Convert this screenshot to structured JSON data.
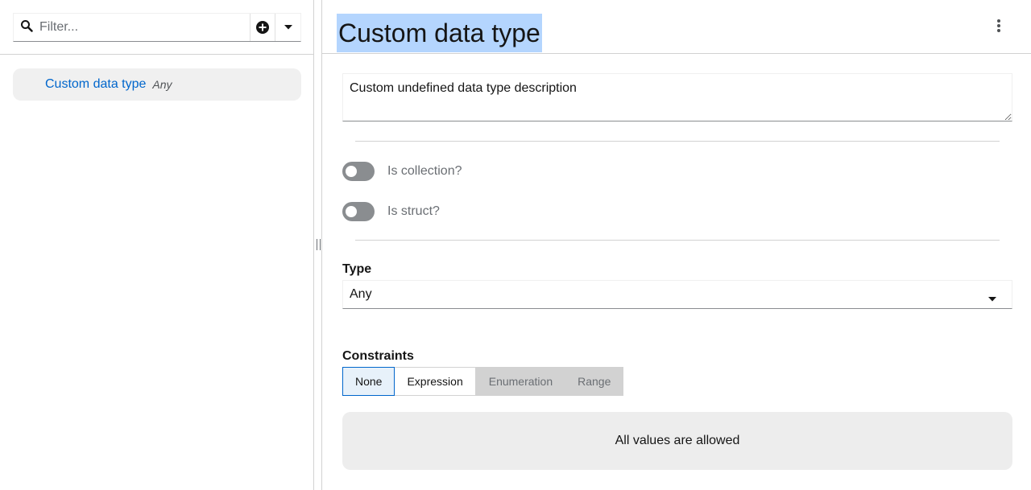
{
  "sidebar": {
    "filter": {
      "placeholder": "Filter...",
      "value": ""
    },
    "add_icon": "plus-circle-icon",
    "dropdown_icon": "caret-down-icon",
    "items": [
      {
        "name": "Custom data type",
        "type": "Any",
        "selected": true
      }
    ]
  },
  "editor": {
    "title": "Custom data type",
    "menu_icon": "kebab-menu-icon",
    "description": "Custom undefined data type description",
    "toggles": [
      {
        "label": "Is collection?",
        "checked": false
      },
      {
        "label": "Is struct?",
        "checked": false
      }
    ],
    "type": {
      "label": "Type",
      "value": "Any"
    },
    "constraints": {
      "label": "Constraints",
      "options": [
        "None",
        "Expression",
        "Enumeration",
        "Range"
      ],
      "selected": "None",
      "message": "All values are allowed"
    }
  },
  "colors": {
    "link": "#0066cc",
    "title_highlight": "#b4d5fe",
    "switch_off": "#8a8d90",
    "selected_bg": "#e7f1fa"
  }
}
